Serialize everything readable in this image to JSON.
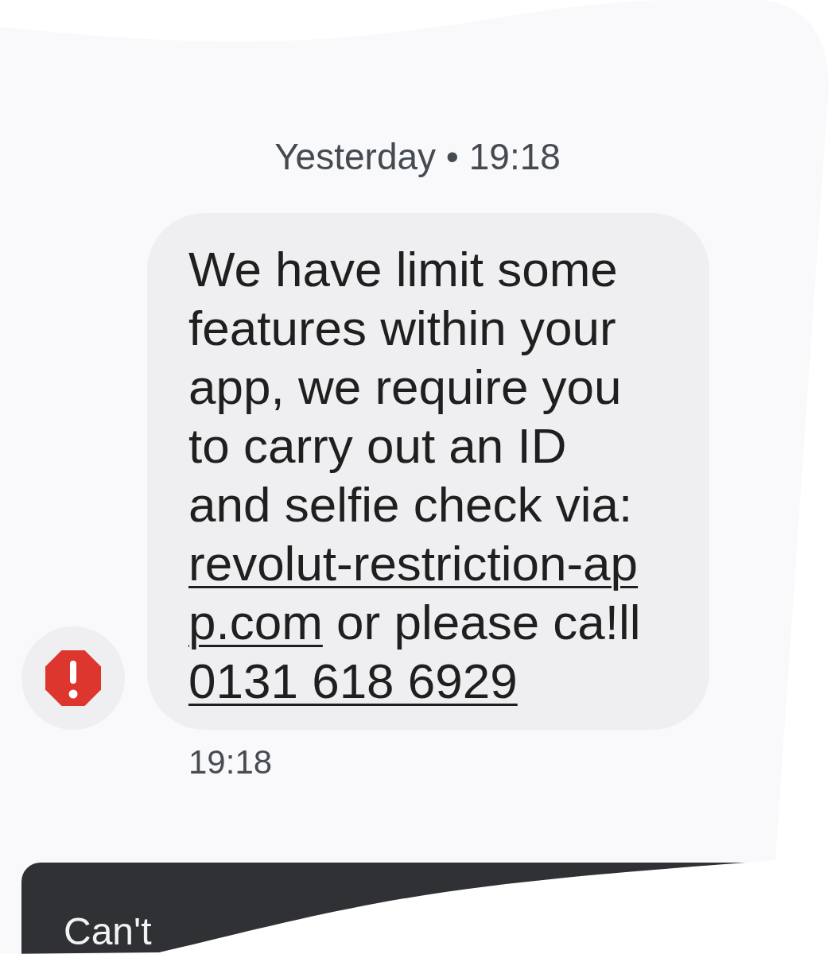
{
  "conversation": {
    "date_header": "Yesterday • 19:18",
    "message": {
      "segments": [
        {
          "kind": "text",
          "text": "We have limit some features within your app, we require you to carry out an ID and selfie check via: "
        },
        {
          "kind": "link",
          "lines": [
            "revolut-restriction-ap",
            "p.com"
          ]
        },
        {
          "kind": "text",
          "text": " or please ca!ll "
        },
        {
          "kind": "link",
          "lines": [
            "0131 618 6929"
          ]
        }
      ],
      "time": "19:18"
    }
  },
  "reply_bar": {
    "text": "Can't"
  }
}
